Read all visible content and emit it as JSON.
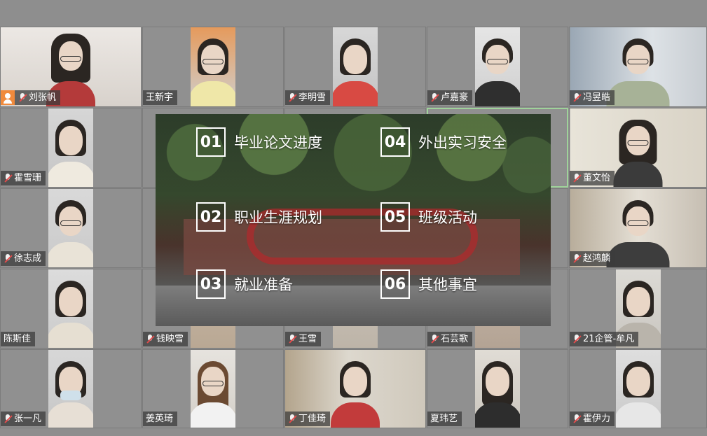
{
  "participants": [
    {
      "name": "刘张帆",
      "mic_muted": true,
      "host": true
    },
    {
      "name": "王新宇",
      "mic_muted": false
    },
    {
      "name": "李明雪",
      "mic_muted": true
    },
    {
      "name": "卢嘉豪",
      "mic_muted": true
    },
    {
      "name": "冯昱皓",
      "mic_muted": true
    },
    {
      "name": "霍雪珊",
      "mic_muted": true
    },
    {
      "name": "董文怡",
      "mic_muted": true
    },
    {
      "name": "徐志成",
      "mic_muted": true
    },
    {
      "name": "赵鸿麟",
      "mic_muted": true
    },
    {
      "name": "陈斯佳",
      "mic_muted": false
    },
    {
      "name": "钱映雪",
      "mic_muted": true
    },
    {
      "name": "王雪",
      "mic_muted": true
    },
    {
      "name": "石芸歌",
      "mic_muted": true
    },
    {
      "name": "21企管-牟凡",
      "mic_muted": true
    },
    {
      "name": "张一凡",
      "mic_muted": true
    },
    {
      "name": "姜英琦",
      "mic_muted": false
    },
    {
      "name": "丁佳琦",
      "mic_muted": true
    },
    {
      "name": "夏玮艺",
      "mic_muted": false
    },
    {
      "name": "霍伊力",
      "mic_muted": true
    }
  ],
  "slide": {
    "items": [
      {
        "num": "01",
        "text": "毕业论文进度"
      },
      {
        "num": "02",
        "text": "职业生涯规划"
      },
      {
        "num": "03",
        "text": "就业准备"
      },
      {
        "num": "04",
        "text": "外出实习安全"
      },
      {
        "num": "05",
        "text": "班级活动"
      },
      {
        "num": "06",
        "text": "其他事宜"
      }
    ]
  }
}
